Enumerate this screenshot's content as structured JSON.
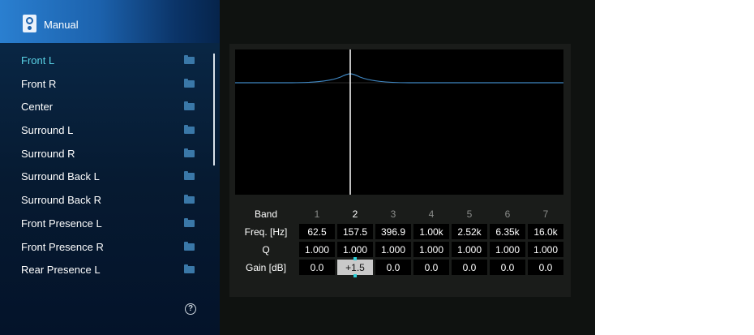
{
  "sidebar": {
    "title": "Manual",
    "header_icon": "speaker-icon",
    "items": [
      {
        "label": "Front L",
        "active": true
      },
      {
        "label": "Front R"
      },
      {
        "label": "Center"
      },
      {
        "label": "Surround L"
      },
      {
        "label": "Surround R"
      },
      {
        "label": "Surround Back L"
      },
      {
        "label": "Surround Back R"
      },
      {
        "label": "Front Presence L"
      },
      {
        "label": "Front Presence R"
      },
      {
        "label": "Rear Presence L"
      }
    ],
    "item_icon": "folder-icon",
    "help_label": "?"
  },
  "eq": {
    "row_labels": {
      "band": "Band",
      "freq": "Freq. [Hz]",
      "q": "Q",
      "gain": "Gain [dB]"
    },
    "bands": [
      "1",
      "2",
      "3",
      "4",
      "5",
      "6",
      "7"
    ],
    "selected_band": 2,
    "freq": [
      "62.5",
      "157.5",
      "396.9",
      "1.00k",
      "2.52k",
      "6.35k",
      "16.0k"
    ],
    "q": [
      "1.000",
      "1.000",
      "1.000",
      "1.000",
      "1.000",
      "1.000",
      "1.000"
    ],
    "gain": [
      "0.0",
      "+1.5",
      "0.0",
      "0.0",
      "0.0",
      "0.0",
      "0.0"
    ]
  },
  "colors": {
    "accent": "#5ad3e6",
    "curve": "#3f86c1",
    "cursor": "#ffffff",
    "selection_marker": "#2fd0d9"
  }
}
